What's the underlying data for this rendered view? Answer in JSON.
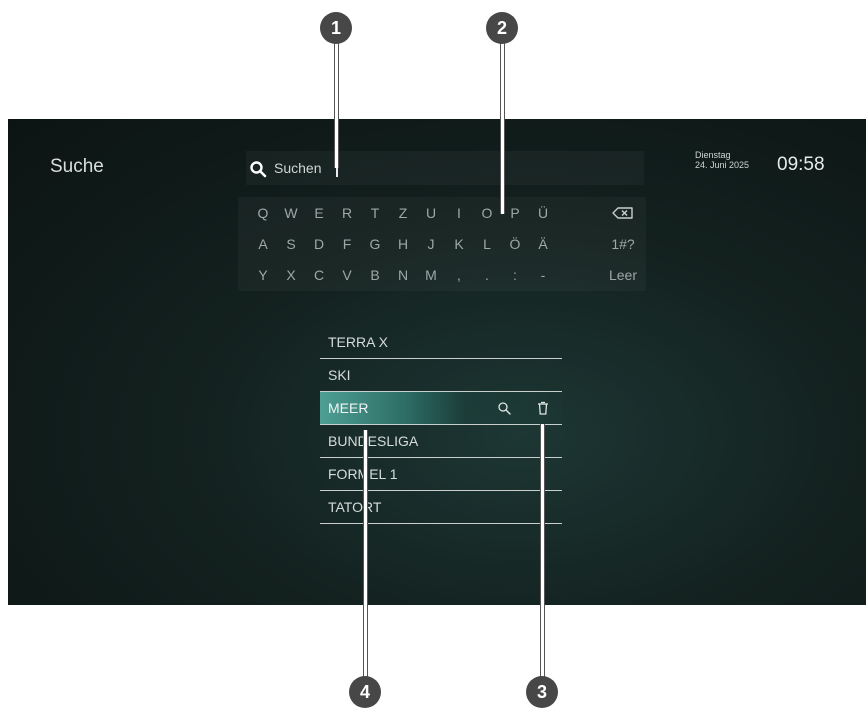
{
  "header": {
    "page_title": "Suche",
    "search_text": "Suchen",
    "weekday": "Dienstag",
    "date": "24. Juni 2025",
    "time": "09:58"
  },
  "keyboard": {
    "row1": [
      "Q",
      "W",
      "E",
      "R",
      "T",
      "Z",
      "U",
      "I",
      "O",
      "P",
      "Ü"
    ],
    "row2": [
      "A",
      "S",
      "D",
      "F",
      "G",
      "H",
      "J",
      "K",
      "L",
      "Ö",
      "Ä"
    ],
    "row3": [
      "Y",
      "X",
      "C",
      "V",
      "B",
      "N",
      "M",
      ",",
      ".",
      ":",
      "-"
    ],
    "symbols_label": "1#?",
    "space_label": "Leer"
  },
  "history": [
    "TERRA X",
    "SKI",
    "MEER",
    "BUNDESLIGA",
    "FORMEL 1",
    "TATORT"
  ],
  "callouts": [
    "1",
    "2",
    "3",
    "4"
  ],
  "colors": {
    "accent": "#4e9f94",
    "background": "#13211f",
    "callout": "#474747"
  }
}
